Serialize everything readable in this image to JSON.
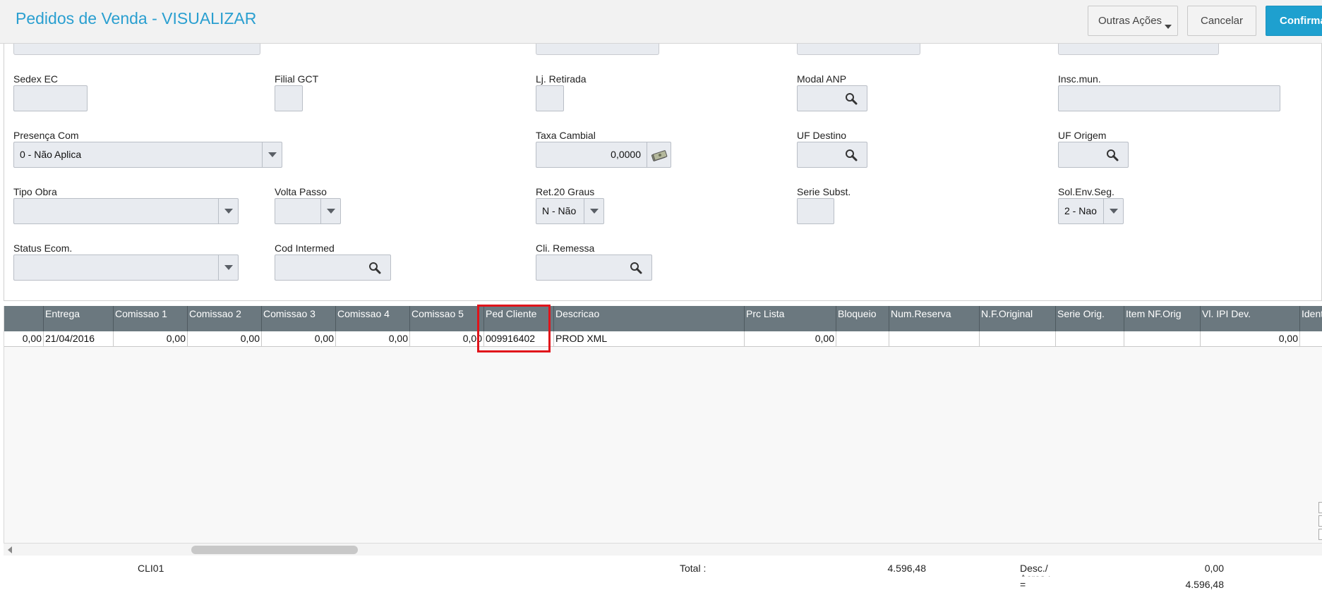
{
  "header": {
    "title": "Pedidos de Venda - VISUALIZAR",
    "other_actions": "Outras Ações",
    "cancel": "Cancelar",
    "confirm": "Confirmar"
  },
  "form": {
    "sedex_ec": {
      "label": "Sedex EC",
      "value": ""
    },
    "filial_gct": {
      "label": "Filial GCT",
      "value": ""
    },
    "lj_retirada": {
      "label": "Lj. Retirada",
      "value": ""
    },
    "modal_anp": {
      "label": "Modal ANP",
      "value": ""
    },
    "insc_mun": {
      "label": "Insc.mun.",
      "value": ""
    },
    "presenca_com": {
      "label": "Presença Com",
      "value": "0 - Não Aplica"
    },
    "taxa_cambial": {
      "label": "Taxa Cambial",
      "value": "0,0000"
    },
    "uf_destino": {
      "label": "UF Destino",
      "value": ""
    },
    "uf_origem": {
      "label": "UF Origem",
      "value": ""
    },
    "tipo_obra": {
      "label": "Tipo Obra",
      "value": ""
    },
    "volta_passo": {
      "label": "Volta Passo",
      "value": ""
    },
    "ret_20_graus": {
      "label": "Ret.20 Graus",
      "value": "N - Não"
    },
    "serie_subst": {
      "label": "Serie Subst.",
      "value": ""
    },
    "sol_env_seg": {
      "label": "Sol.Env.Seg.",
      "value": "2 - Nao"
    },
    "status_ecom": {
      "label": "Status Ecom.",
      "value": ""
    },
    "cod_intermed": {
      "label": "Cod Intermed",
      "value": ""
    },
    "cli_remessa": {
      "label": "Cli. Remessa",
      "value": ""
    }
  },
  "grid": {
    "columns": [
      "",
      "Entrega",
      "Comissao 1",
      "Comissao 2",
      "Comissao 3",
      "Comissao 4",
      "Comissao 5",
      "Ped Cliente",
      "Descricao",
      "Prc Lista",
      "Bloqueio",
      "Num.Reserva",
      "N.F.Original",
      "Serie Orig.",
      "Item NF.Orig",
      "Vl. IPI Dev.",
      "Ident."
    ],
    "rows": [
      [
        "0,00",
        "21/04/2016",
        "0,00",
        "0,00",
        "0,00",
        "0,00",
        "0,00",
        "009916402",
        "PROD XML",
        "0,00",
        "",
        "",
        "",
        "",
        "",
        "0,00",
        ""
      ]
    ],
    "highlighted_column": "Ped Cliente"
  },
  "footer": {
    "client": "CLI01",
    "total_label": "Total :",
    "total_value": "4.596,48",
    "desc_label": "Desc./",
    "desc_value": "0,00",
    "acresc_label": "Acres.:",
    "eq_label": "=",
    "net_value": "4.596,48"
  },
  "icons": [
    "lookup-search-icon",
    "money-icon",
    "dropdown-caret-icon"
  ],
  "colors": {
    "title": "#2a9fd0",
    "confirm": "#1ea0cf",
    "grid_header": "#6b787f",
    "highlight": "#e0141b"
  }
}
